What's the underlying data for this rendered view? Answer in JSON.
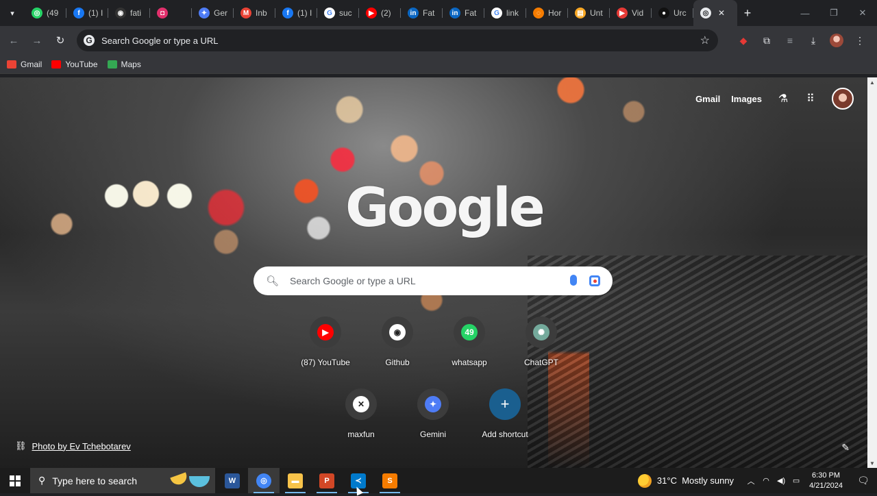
{
  "tabs": [
    {
      "title": "(49",
      "icon": "whatsapp-icon",
      "color": "#25d366",
      "glyph": "◎"
    },
    {
      "title": "(1) I",
      "icon": "facebook-icon",
      "color": "#1877f2",
      "glyph": "f"
    },
    {
      "title": "fati",
      "icon": "github-icon",
      "color": "#333333",
      "glyph": "◉"
    },
    {
      "title": "",
      "icon": "instagram-icon",
      "color": "#e1306c",
      "glyph": "◘"
    },
    {
      "title": "Ger",
      "icon": "gemini-icon",
      "color": "#4e7cf6",
      "glyph": "✦"
    },
    {
      "title": "Inb",
      "icon": "gmail-icon",
      "color": "#ea4335",
      "glyph": "M"
    },
    {
      "title": "(1) I",
      "icon": "facebook-icon",
      "color": "#1877f2",
      "glyph": "f"
    },
    {
      "title": "suc",
      "icon": "google-icon",
      "color": "#ffffff",
      "glyph": "G"
    },
    {
      "title": "(2)",
      "icon": "youtube-icon",
      "color": "#ff0000",
      "glyph": "▶"
    },
    {
      "title": "Fat",
      "icon": "linkedin-icon",
      "color": "#0a66c2",
      "glyph": "in"
    },
    {
      "title": "Fat",
      "icon": "linkedin-icon",
      "color": "#0a66c2",
      "glyph": "in"
    },
    {
      "title": "link",
      "icon": "google-icon",
      "color": "#ffffff",
      "glyph": "G"
    },
    {
      "title": "Hor",
      "icon": "loader-icon",
      "color": "#f57c00",
      "glyph": "◌"
    },
    {
      "title": "Unt",
      "icon": "document-icon",
      "color": "#f9a825",
      "glyph": "▤"
    },
    {
      "title": "Vid",
      "icon": "video-icon",
      "color": "#e53935",
      "glyph": "▶"
    },
    {
      "title": "Urc",
      "icon": "app-icon",
      "color": "#111111",
      "glyph": "●"
    }
  ],
  "active_tab": {
    "icon": "chrome-icon"
  },
  "omnibox": {
    "placeholder": "Search Google or type a URL"
  },
  "bookmarks": [
    {
      "label": "Gmail",
      "icon": "gmail-icon",
      "color": "#ea4335"
    },
    {
      "label": "YouTube",
      "icon": "youtube-icon",
      "color": "#ff0000"
    },
    {
      "label": "Maps",
      "icon": "maps-icon",
      "color": "#34a853"
    }
  ],
  "ntp": {
    "top_links": {
      "gmail": "Gmail",
      "images": "Images"
    },
    "logo": "Google",
    "search_placeholder": "Search Google or type a URL",
    "shortcuts_row1": [
      {
        "label": "(87) YouTube",
        "icon": "youtube-icon",
        "color": "#ff0000",
        "glyph": "▶"
      },
      {
        "label": "Github",
        "icon": "github-icon",
        "color": "#ffffff",
        "glyph": "◉"
      },
      {
        "label": "whatsapp",
        "icon": "whatsapp-icon",
        "color": "#25d366",
        "glyph": "49"
      },
      {
        "label": "ChatGPT",
        "icon": "chatgpt-icon",
        "color": "#74aa9c",
        "glyph": "✺"
      }
    ],
    "shortcuts_row2": [
      {
        "label": "maxfun",
        "icon": "maxfun-icon",
        "color": "#ffffff",
        "glyph": "✕"
      },
      {
        "label": "Gemini",
        "icon": "gemini-icon",
        "color": "#4e7cf6",
        "glyph": "✦"
      },
      {
        "label": "Add shortcut",
        "icon": "plus-icon",
        "color": "#1a5f8f",
        "glyph": "+"
      }
    ],
    "photo_credit": "Photo by Ev Tchebotarev"
  },
  "taskbar": {
    "search_placeholder": "Type here to search",
    "apps": [
      {
        "name": "word",
        "icon": "word-icon",
        "color": "#2b579a",
        "glyph": "W"
      },
      {
        "name": "chrome",
        "icon": "chrome-icon",
        "color": "#4285f4",
        "glyph": "◎"
      },
      {
        "name": "file-explorer",
        "icon": "folder-icon",
        "color": "#f8c34a",
        "glyph": "▬"
      },
      {
        "name": "powerpoint",
        "icon": "powerpoint-icon",
        "color": "#d24726",
        "glyph": "P"
      },
      {
        "name": "vscode",
        "icon": "vscode-icon",
        "color": "#007acc",
        "glyph": "≺"
      },
      {
        "name": "sublime",
        "icon": "sublime-icon",
        "color": "#f57c00",
        "glyph": "S"
      }
    ],
    "weather": {
      "temp": "31°C",
      "desc": "Mostly sunny"
    },
    "time": "6:30 PM",
    "date": "4/21/2024"
  }
}
